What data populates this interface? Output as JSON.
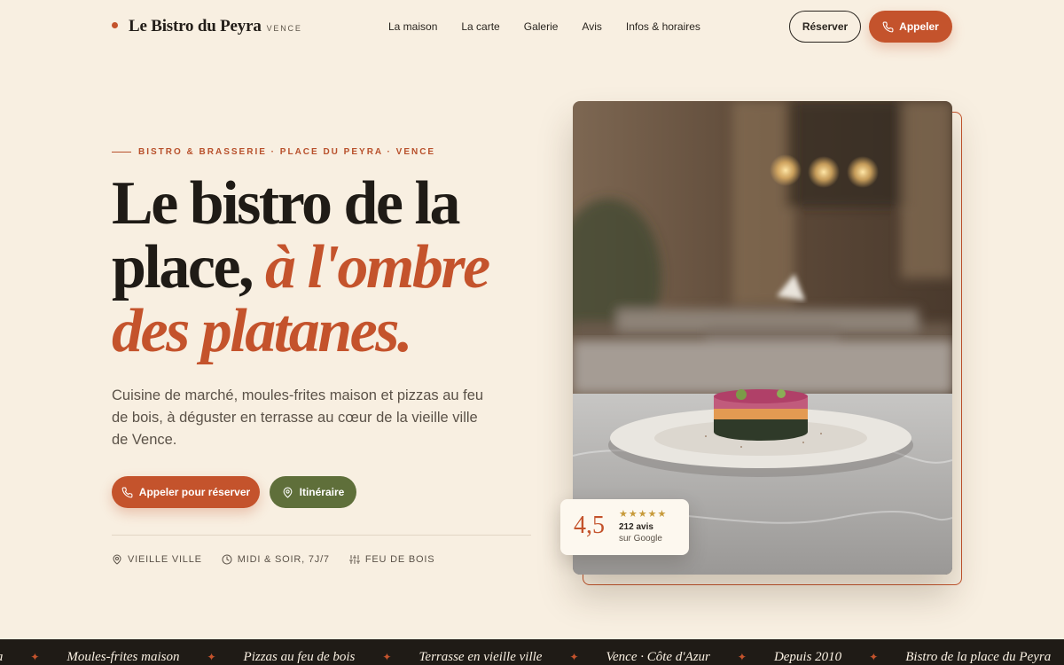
{
  "nav": {
    "brand_name": "Le Bistro du Peyra",
    "brand_sub": "VENCE",
    "links": [
      "La maison",
      "La carte",
      "Galerie",
      "Avis",
      "Infos & horaires"
    ],
    "reserve_label": "Réserver",
    "call_label": "Appeler"
  },
  "hero": {
    "eyebrow": "BISTRO & BRASSERIE · PLACE DU PEYRA · VENCE",
    "headline_line1": "Le bistro de la",
    "headline_line2_plain": "place,",
    "headline_line2_italic": "à l'ombre",
    "headline_line3_italic": "des platanes.",
    "lead": "Cuisine de marché, moules-frites maison et pizzas au feu de bois, à déguster en terrasse au cœur de la vieille ville de Vence.",
    "cta_primary": "Appeler pour réserver",
    "cta_secondary": "Itinéraire",
    "facts": [
      {
        "icon": "map-pin-icon",
        "label": "VIEILLE VILLE"
      },
      {
        "icon": "clock-icon",
        "label": "MIDI & SOIR, 7J/7"
      },
      {
        "icon": "sliders-icon",
        "label": "FEU DE BOIS"
      }
    ]
  },
  "rating": {
    "score": "4,5",
    "stars": "★★★★★",
    "count": "212 avis",
    "source": "sur Google"
  },
  "marquee": {
    "items": [
      "ra",
      "Moules-frites maison",
      "Pizzas au feu de bois",
      "Terrasse en vieille ville",
      "Vence · Côte d'Azur",
      "Depuis 2010",
      "Bistro de la place du Peyra"
    ],
    "separator": "✦"
  },
  "colors": {
    "background": "#f8efe1",
    "accent": "#c4532c",
    "olive": "#5f6f3a",
    "ink": "#1f1b16"
  }
}
